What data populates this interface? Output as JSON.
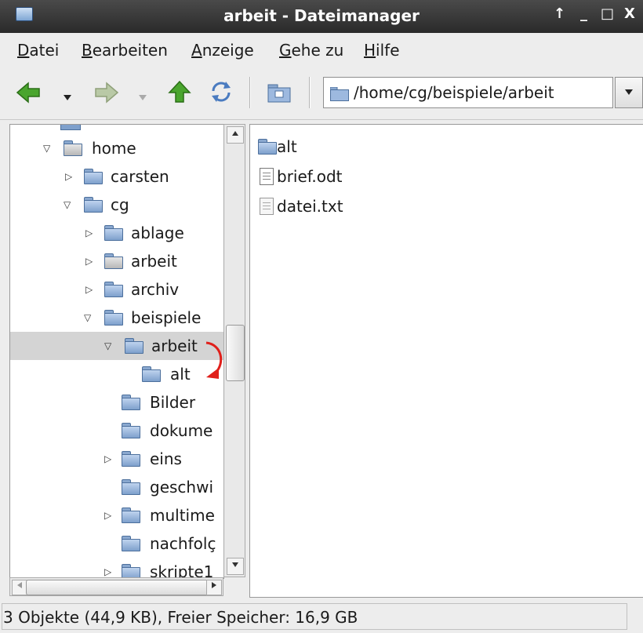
{
  "window": {
    "title": "arbeit - Dateimanager",
    "btn_up": "↑",
    "btn_min": "_",
    "btn_max": "□",
    "btn_close": "X"
  },
  "menu": [
    {
      "label_ul": "D",
      "label_rest": "atei"
    },
    {
      "label_ul": "B",
      "label_rest": "earbeiten"
    },
    {
      "label_ul": "A",
      "label_rest": "nzeige"
    },
    {
      "label_ul": "G",
      "label_rest": "ehe zu"
    },
    {
      "label_ul": "H",
      "label_rest": "ilfe"
    }
  ],
  "toolbar": {
    "path": "/home/cg/beispiele/arbeit"
  },
  "tree": [
    {
      "label": "home",
      "expander": "open"
    },
    {
      "label": "carsten",
      "expander": "closed"
    },
    {
      "label": "cg",
      "expander": "open"
    },
    {
      "label": "ablage",
      "expander": "closed"
    },
    {
      "label": "arbeit",
      "expander": "closed"
    },
    {
      "label": "archiv",
      "expander": "closed"
    },
    {
      "label": "beispiele",
      "expander": "open"
    },
    {
      "label": "arbeit",
      "expander": "open",
      "selected": true
    },
    {
      "label": "alt",
      "expander": "none"
    },
    {
      "label": "Bilder",
      "expander": "none"
    },
    {
      "label": "dokume",
      "expander": "none"
    },
    {
      "label": "eins",
      "expander": "closed"
    },
    {
      "label": "geschwi",
      "expander": "none"
    },
    {
      "label": "multime",
      "expander": "closed"
    },
    {
      "label": "nachfolç",
      "expander": "none"
    },
    {
      "label": "skripte1",
      "expander": "closed"
    }
  ],
  "files": [
    {
      "name": "alt",
      "icon": "folder-icon"
    },
    {
      "name": "brief.odt",
      "icon": "document-icon"
    },
    {
      "name": "datei.txt",
      "icon": "text-file-icon"
    }
  ],
  "status": {
    "text": "3 Objekte (44,9 KB), Freier Speicher: 16,9 GB"
  },
  "colors": {
    "arrow_annotation": "#e0201b",
    "nav_green": "#4aa52e",
    "folder_blue": "#7ea0cc"
  }
}
